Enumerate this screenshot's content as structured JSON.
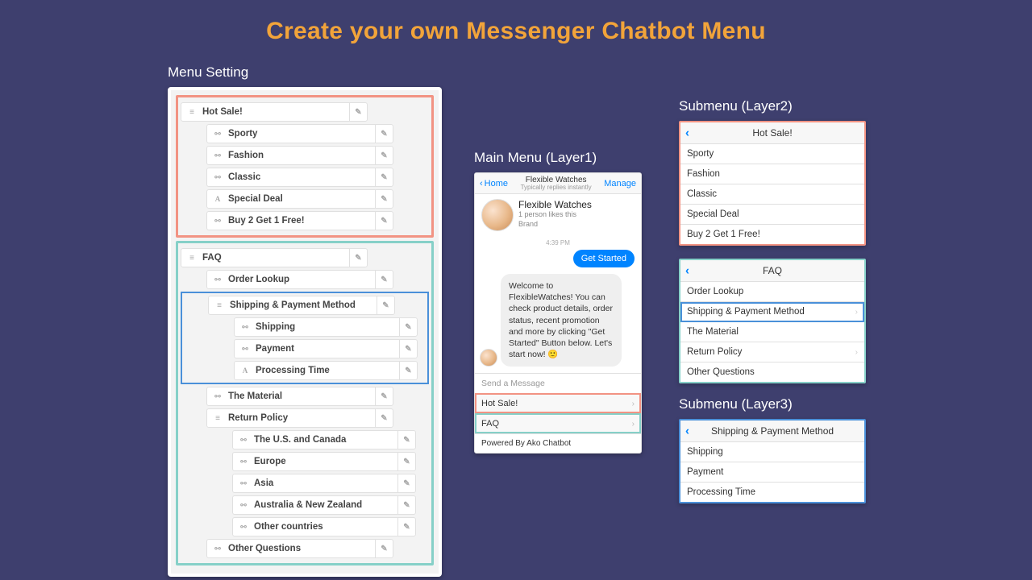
{
  "title": "Create your own Messenger Chatbot Menu",
  "sections": {
    "menu_setting": "Menu Setting",
    "main_menu": "Main Menu (Layer1)",
    "submenu2": "Submenu (Layer2)",
    "submenu3": "Submenu (Layer3)"
  },
  "tree": {
    "hot_sale": {
      "label": "Hot Sale!",
      "children": [
        "Sporty",
        "Fashion",
        "Classic",
        "Special Deal",
        "Buy 2 Get 1 Free!"
      ]
    },
    "faq": {
      "label": "FAQ",
      "order_lookup": "Order Lookup",
      "shipping_payment": {
        "label": "Shipping & Payment Method",
        "children": [
          "Shipping",
          "Payment",
          "Processing Time"
        ]
      },
      "the_material": "The Material",
      "return_policy": {
        "label": "Return Policy",
        "children": [
          "The U.S. and Canada",
          "Europe",
          "Asia",
          "Australia & New Zealand",
          "Other countries"
        ]
      },
      "other_questions": "Other Questions"
    }
  },
  "messenger": {
    "home": "Home",
    "title": "Flexible Watches",
    "subtitle": "Typically replies instantly",
    "manage": "Manage",
    "brand_name": "Flexible Watches",
    "likes": "1 person likes this",
    "category": "Brand",
    "time": "4:39 PM",
    "get_started": "Get Started",
    "welcome": "Welcome to FlexibleWatches! You can check product details, order status, recent promotion and more by clicking \"Get Started\" Button below. Let's start now! 🙂",
    "compose": "Send a Message",
    "menu1": "Hot Sale!",
    "menu2": "FAQ",
    "powered": "Powered By Ako Chatbot"
  },
  "subcards": {
    "hot_sale": {
      "title": "Hot Sale!",
      "items": [
        "Sporty",
        "Fashion",
        "Classic",
        "Special Deal",
        "Buy 2 Get 1 Free!"
      ]
    },
    "faq": {
      "title": "FAQ",
      "items": [
        "Order Lookup",
        "Shipping & Payment Method",
        "The Material",
        "Return Policy",
        "Other Questions"
      ]
    },
    "shipping": {
      "title": "Shipping & Payment Method",
      "items": [
        "Shipping",
        "Payment",
        "Processing Time"
      ]
    }
  }
}
